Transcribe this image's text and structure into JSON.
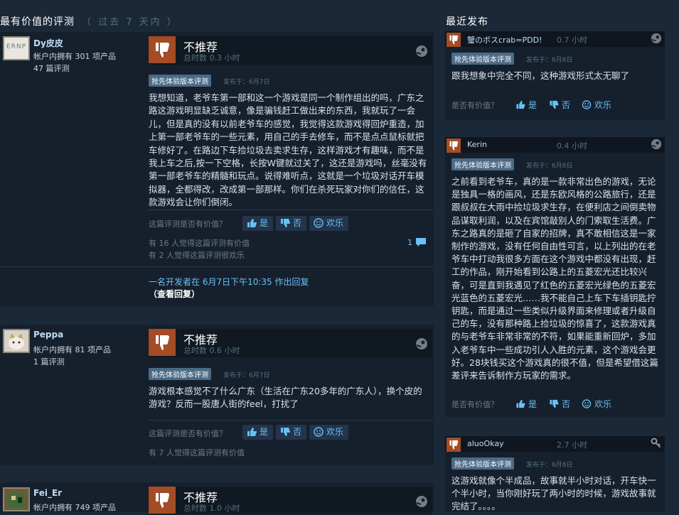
{
  "left_section": {
    "title": "最有价值的评测",
    "subtitle": "（ 过去 7 天内 ）"
  },
  "right_section": {
    "title": "最近发布"
  },
  "reviews": [
    {
      "author": "Dy皮皮",
      "avatar_text": "ERNP",
      "products": "帐户内拥有 301 项产品",
      "review_count": "47 篇评测",
      "verdict": "不推荐",
      "playtime": "总时数 0.3 小时",
      "badge": "抢先体验版本评测",
      "posted": "发布于：6月7日",
      "text": "我想知道，老爷车第一部和这一个游戏是同一个制作组出的吗，广东之路这游戏明显缺乏诚意，像是骗钱赶工做出来的东西，我就玩了一会儿，但是真的没有以前老爷车的感觉，我觉得这款游戏得回炉重造，加上第一部老爷车的一些元素，用自己的手去修车，而不是点点鼠标就把车修好了。在路边下车捡垃圾去卖求生存，这样游戏才有趣味，而不是我上车之后,按一下空格，长按W键就过关了，这还是游戏吗，丝毫没有第一部老爷车的精髓和玩点。说得难听点，这就是一个垃圾对话开车模拟器，全都得改，改成第一部那样。你们在杀死玩家对你们的信任，这款游戏会让你们倒闭。",
      "helpful_q": "这篇评测是否有价值？",
      "yes": "是",
      "no": "否",
      "funny": "欢乐",
      "stat1": "有 16 人觉得这篇评测有价值",
      "stat2": "有 2 人觉得这篇评测很欢乐",
      "comments": "1",
      "dev_reply": "一名开发者在 6月7日下午10:35 作出回复",
      "view_reply": "（查看回复）"
    },
    {
      "author": "Peppa",
      "products": "帐户内拥有 81 项产品",
      "review_count": "1 篇评测",
      "verdict": "不推荐",
      "playtime": "总时数 0.6 小时",
      "badge": "抢先体验版本评测",
      "posted": "发布于：6月7日",
      "text": "游戏根本感觉不了什么广东（生活在广东20多年的广东人），换个皮的游戏？反而一股唐人街的feel，打扰了",
      "helpful_q": "这篇评测是否有价值？",
      "yes": "是",
      "no": "否",
      "funny": "欢乐",
      "stat1": "有 7 人觉得这篇评测有价值"
    },
    {
      "author": "Fei_Er",
      "products": "帐户内拥有 749 项产品",
      "verdict": "不推荐",
      "playtime": "总时数 1.0 小时"
    }
  ],
  "recent": [
    {
      "name": "蟹のボスcrab=PDD!",
      "time": "0.7 小时",
      "badge": "抢先体验版本评测",
      "posted": "发布于：6月8日",
      "text": "跟我想象中完全不同，这种游戏形式太无聊了",
      "helpful_q": "是否有价值？",
      "yes": "是",
      "no": "否",
      "funny": "欢乐"
    },
    {
      "name": "Kerin",
      "time": "0.4 小时",
      "badge": "抢先体验版本评测",
      "posted": "发布于：6月8日",
      "text": "之前看到老爷车，真的是一款非常出色的游戏，无论是独具一格的画风，还是东欧风格的公路旅行，还是跟叔叔在大雨中捡垃圾求生存，在便利店之间倒卖物品谋取利润，以及在宾馆敲别人的门索取生活费。广东之路真的是砸了自家的招牌，真不敢相信这是一家制作的游戏，没有任何自由性可言，以上列出的在老爷车中打动我很多方面在这个游戏中都没有出现，赶工的作品，刚开始看到公路上的五菱宏光还比较兴奋，可是直到我遇见了红色的五菱宏光绿色的五菱宏光蓝色的五菱宏光……我不能自己上车下车插钥匙拧钥匙，而是通过一些类似升级界面来修理或者升级自己的车，没有那种路上捡垃圾的惊喜了，这款游戏真的与老爷车非常非常的不符，如果能重新回炉，多加入老爷车中一些成功引人入胜的元素，这个游戏会更好。28块钱买这个游戏真的很不值，但是希望借这篇差评来告诉制作方玩家的需求。",
      "helpful_q": "是否有价值？",
      "yes": "是",
      "no": "否",
      "funny": "欢乐"
    },
    {
      "name": "aluoOkay",
      "time": "2.7 小时",
      "badge": "抢先体验版本评测",
      "posted": "发布于：6月8日",
      "text": "这游戏就像个半成品，故事就半小时对话，开车快一个半小时，当你刚好玩了两小时的时候，游戏故事就完结了。。。。"
    }
  ]
}
